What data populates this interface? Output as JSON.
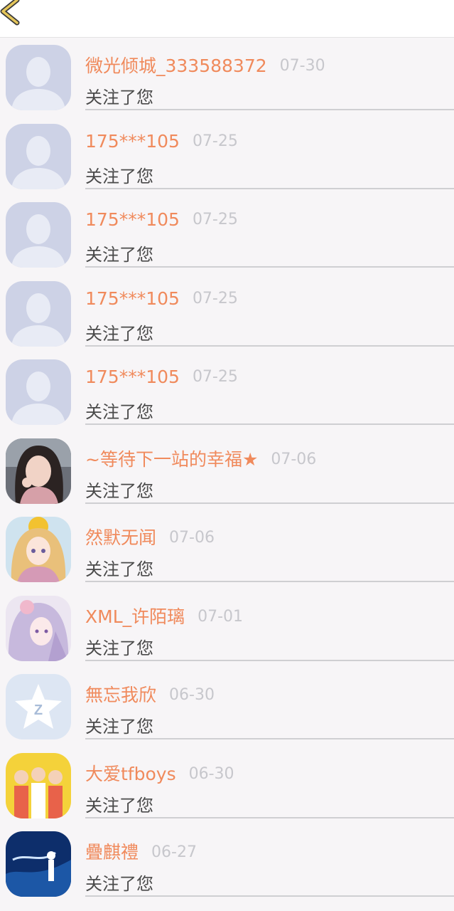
{
  "header": {
    "back_icon": "chevron-left-icon",
    "accent": "#e5c65a"
  },
  "colors": {
    "name": "#f08a5c",
    "date": "#c7c7cc",
    "action": "#4a4a4a",
    "background": "#f7f5f7"
  },
  "notifications": [
    {
      "name": "微光倾城_333588372",
      "date": "07-30",
      "action": "关注了您",
      "avatar": "default-avatar"
    },
    {
      "name": "175***105",
      "date": "07-25",
      "action": "关注了您",
      "avatar": "default-avatar"
    },
    {
      "name": "175***105",
      "date": "07-25",
      "action": "关注了您",
      "avatar": "default-avatar"
    },
    {
      "name": "175***105",
      "date": "07-25",
      "action": "关注了您",
      "avatar": "default-avatar"
    },
    {
      "name": "175***105",
      "date": "07-25",
      "action": "关注了您",
      "avatar": "default-avatar"
    },
    {
      "name": "~等待下一站的幸福★",
      "date": "07-06",
      "action": "关注了您",
      "avatar": "photo-avatar"
    },
    {
      "name": "然默无闻",
      "date": "07-06",
      "action": "关注了您",
      "avatar": "anime-avatar"
    },
    {
      "name": "XML_许陌璃",
      "date": "07-01",
      "action": "关注了您",
      "avatar": "anime-avatar"
    },
    {
      "name": "無忘我欣",
      "date": "06-30",
      "action": "关注了您",
      "avatar": "star-avatar"
    },
    {
      "name": "大爱tfboys",
      "date": "06-30",
      "action": "关注了您",
      "avatar": "photo-avatar"
    },
    {
      "name": "疊麒禮",
      "date": "06-27",
      "action": "关注了您",
      "avatar": "illustration-avatar"
    }
  ]
}
